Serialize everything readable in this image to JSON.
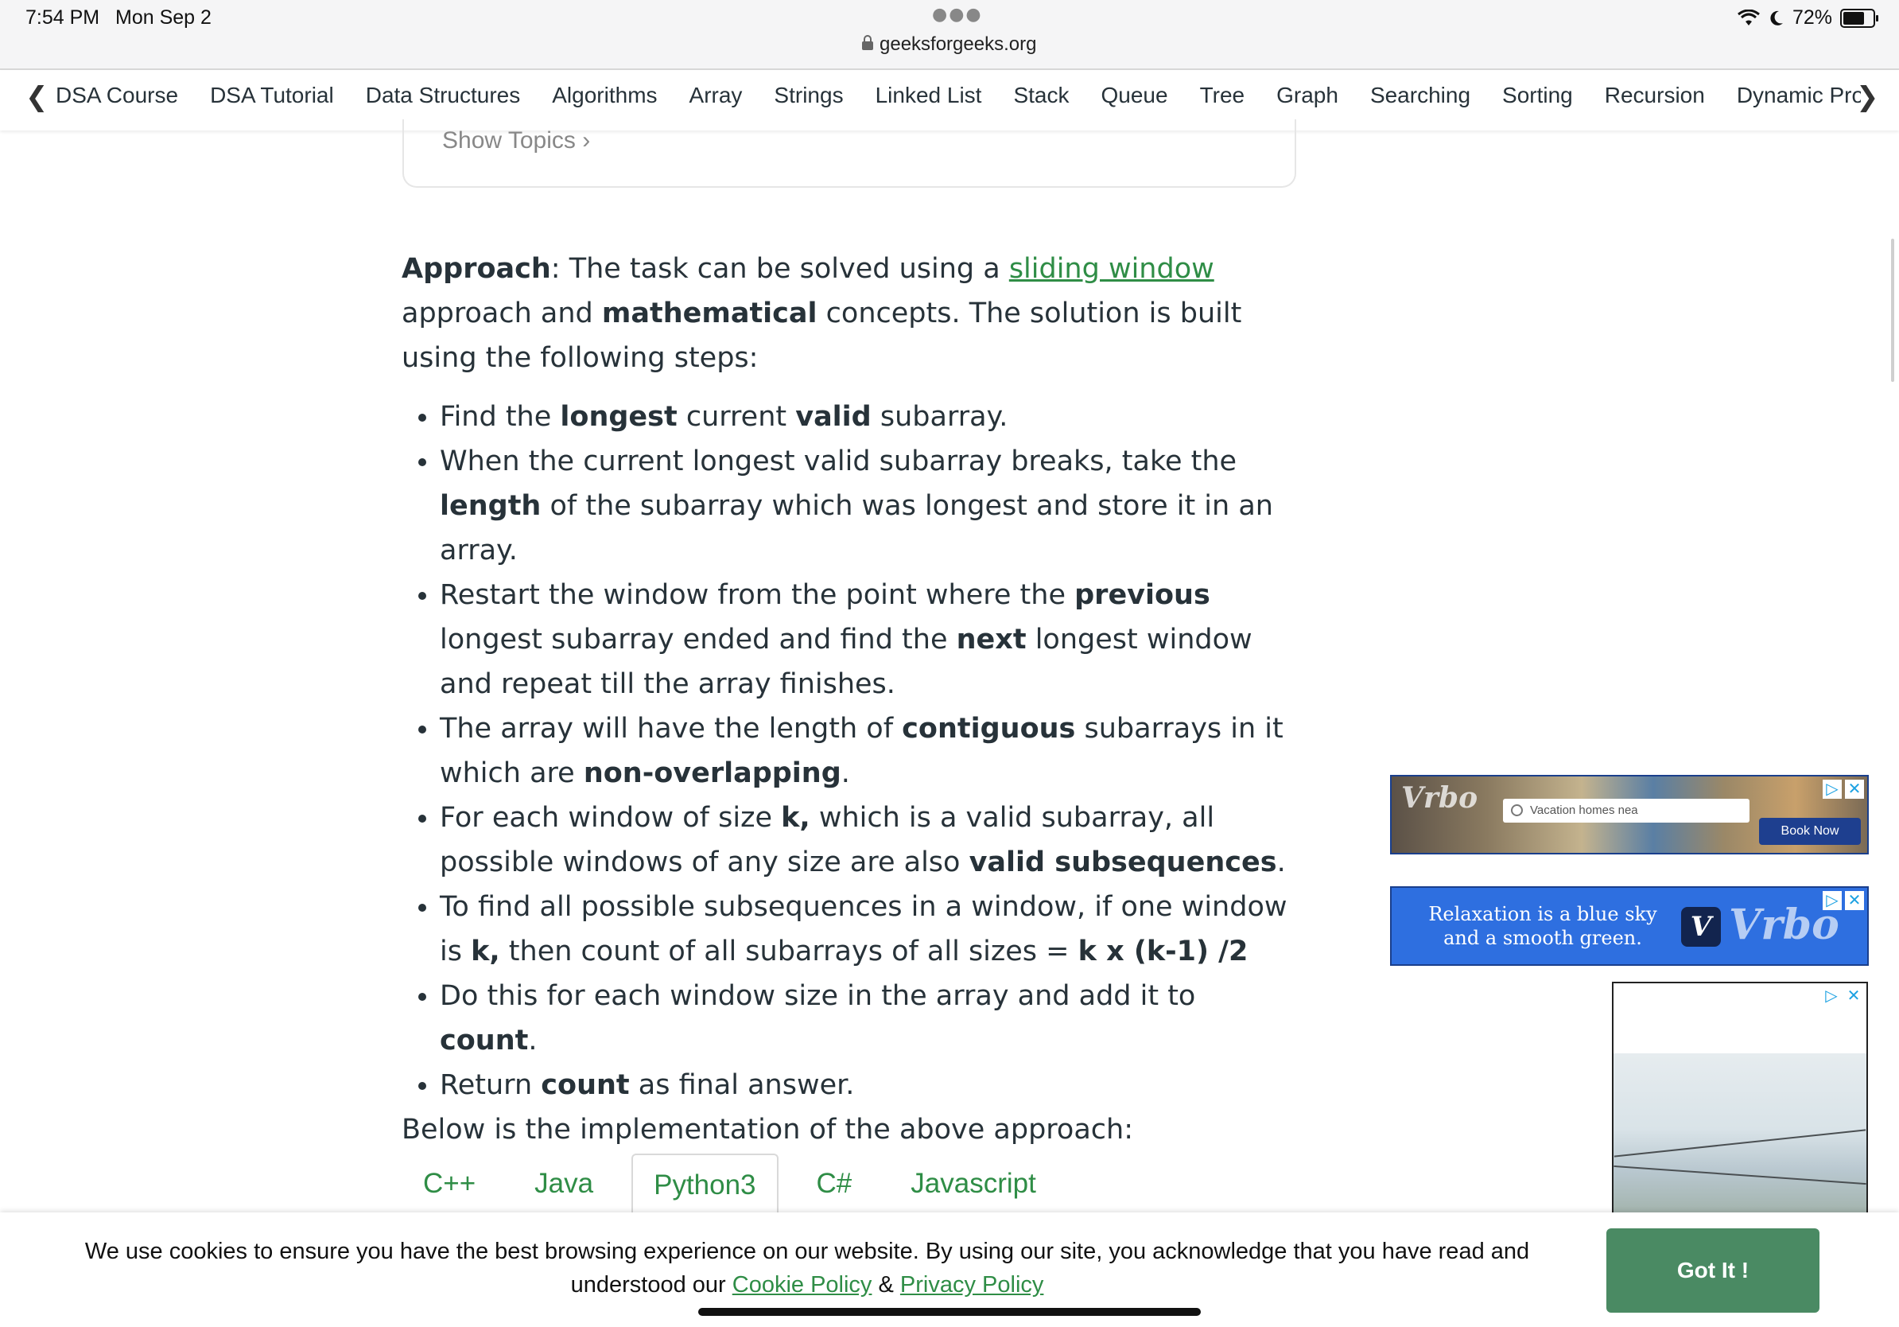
{
  "status_bar": {
    "time": "7:54 PM",
    "date": "Mon Sep 2",
    "url": "geeksforgeeks.org",
    "battery": "72%",
    "battery_level": 0.72
  },
  "nav": {
    "items": [
      "DSA Course",
      "DSA Tutorial",
      "Data Structures",
      "Algorithms",
      "Array",
      "Strings",
      "Linked List",
      "Stack",
      "Queue",
      "Tree",
      "Graph",
      "Searching",
      "Sorting",
      "Recursion",
      "Dynamic Program"
    ]
  },
  "show_topics": "Show Topics",
  "approach": {
    "label": "Approach",
    "text_1": ": The task can be solved using a ",
    "link": "sliding window",
    "text_2": " approach and ",
    "bold_1": "mathematical",
    "text_3": " concepts. The solution is built using the following steps:"
  },
  "steps": [
    {
      "a": "Find the ",
      "b": "longest",
      "c": " current ",
      "d": "valid",
      "e": " subarray."
    },
    {
      "a": "When the current longest valid subarray breaks, take the ",
      "b": "length",
      "c": " of the subarray which was longest and store it in an array."
    },
    {
      "a": "Restart the window from the point where the ",
      "b": "previous",
      "c": " longest subarray ended and find the ",
      "d": "next",
      "e": " longest window and repeat till the array finishes."
    },
    {
      "a": "The array will have the length of ",
      "b": "contiguous",
      "c": " subarrays in it which are ",
      "d": "non-overlapping",
      "e": "."
    },
    {
      "a": "For each window of size ",
      "b": "k,",
      "c": " which is a valid subarray, all possible windows of any size are also ",
      "d": "valid subsequences",
      "e": "."
    },
    {
      "a": "To find all possible subsequences in a window, if one window is ",
      "b": "k,",
      "c": " then count of  all subarrays of all sizes = ",
      "d": "k x (k-1) /2"
    },
    {
      "a": "Do this for each window size in the array and add it to ",
      "b": "count",
      "c": "."
    },
    {
      "a": "Return ",
      "b": "count",
      "c": " as final answer."
    }
  ],
  "below_text": "Below is the implementation of the above approach:",
  "tabs": [
    {
      "label": "C++",
      "active": false
    },
    {
      "label": "Java",
      "active": false
    },
    {
      "label": "Python3",
      "active": true
    },
    {
      "label": "C#",
      "active": false
    },
    {
      "label": "Javascript",
      "active": false
    }
  ],
  "ads": {
    "ad1": {
      "logo": "Vrbo",
      "search_placeholder": "Vacation homes nea",
      "button": "Book Now"
    },
    "ad2": {
      "text_line1": "Relaxation is a blue sky",
      "text_line2": "and a smooth green.",
      "logo": "Vrbo",
      "icon_letter": "V"
    },
    "choices_icon": "▷",
    "close_icon": "✕"
  },
  "cookie": {
    "text": "We use cookies to ensure you have the best browsing experience on our website. By using our site, you acknowledge that you have read and understood our ",
    "link_cookie": "Cookie Policy",
    "amp": " & ",
    "link_privacy": "Privacy Policy",
    "button": "Got It !"
  },
  "colors": {
    "accent": "#2f8d46",
    "button": "#4a8a63",
    "ad_blue": "#2e6fe0"
  }
}
